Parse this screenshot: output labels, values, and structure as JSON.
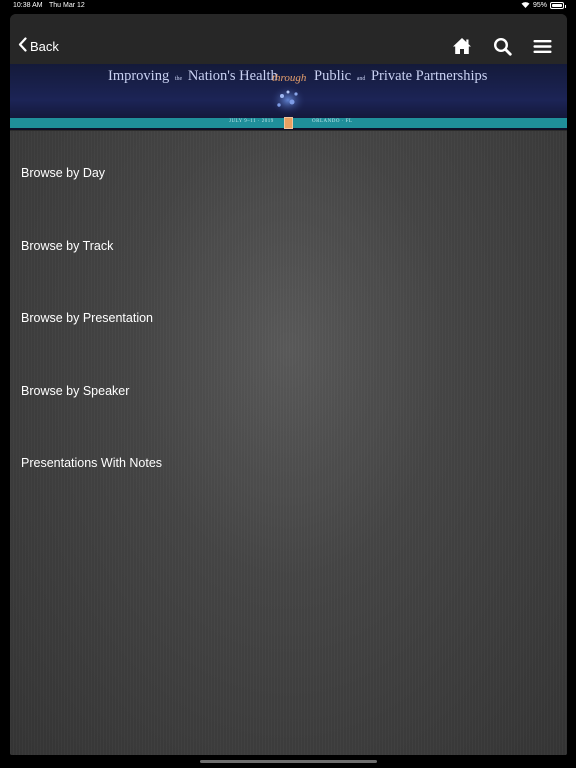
{
  "status_bar": {
    "time": "10:38 AM",
    "date": "Thu Mar 12",
    "battery": "95%",
    "battery_level": 0.95,
    "icons": [
      "wifi-icon",
      "battery-icon"
    ]
  },
  "nav": {
    "back_label": "Back",
    "icons": [
      "home-icon",
      "search-icon",
      "menu-icon"
    ]
  },
  "banner": {
    "left_word1": "Improving",
    "left_small": "the",
    "left_word2": "Nation's Health",
    "through": "through",
    "right_word1": "Public",
    "right_small": "and",
    "right_word2": "Private Partnerships",
    "dates": "JULY 9–11 · 2019",
    "location": "ORLANDO · FL",
    "colors": {
      "background": "#1c2456",
      "stripe": "#1f8f9a",
      "accent": "#e7a06b"
    }
  },
  "menu": {
    "items": [
      {
        "label": "Browse by Day"
      },
      {
        "label": "Browse by Track"
      },
      {
        "label": "Browse by Presentation"
      },
      {
        "label": "Browse by Speaker"
      },
      {
        "label": "Presentations With Notes"
      }
    ]
  }
}
